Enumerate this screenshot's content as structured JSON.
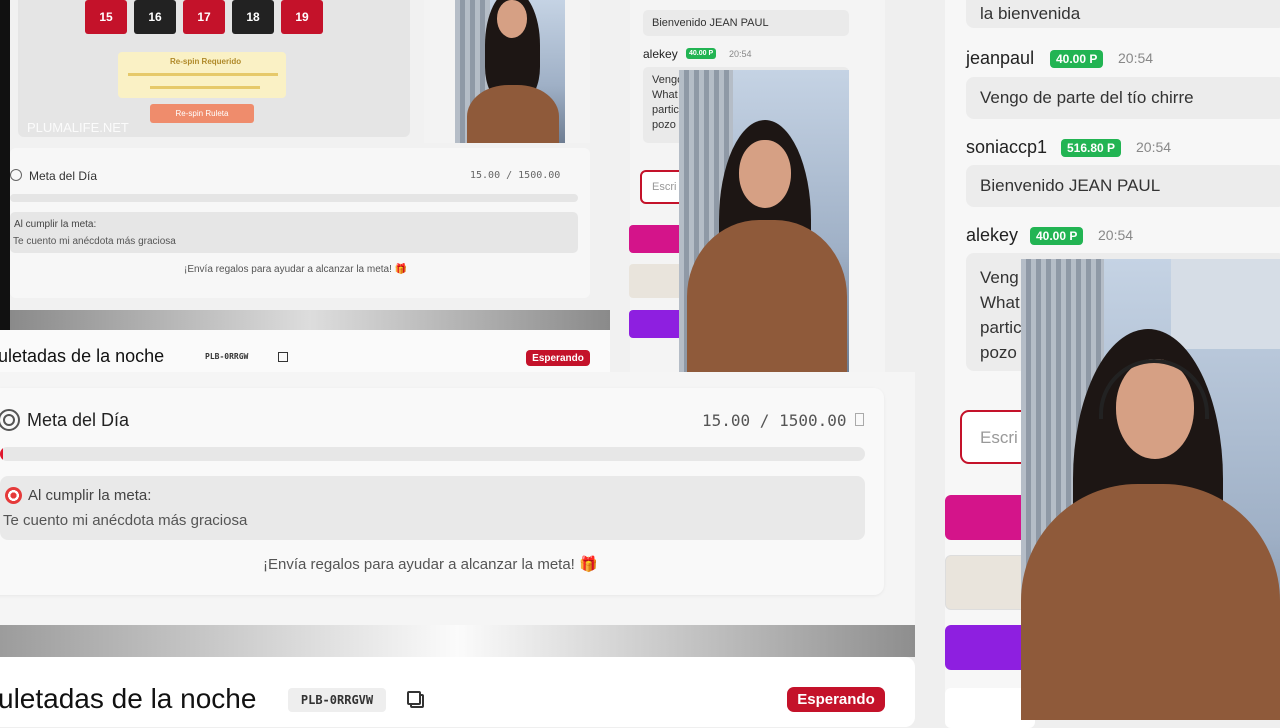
{
  "main": {
    "goal": {
      "title": "Meta del Día",
      "progress": "15.00 / 1500.00",
      "progress_fraction": 0.01,
      "reward_label": "Al cumplir la meta:",
      "reward_text": "Te cuento mi anécdota más graciosa",
      "cta": "¡Envía regalos para ayudar a alcanzar la meta! 🎁"
    },
    "roulette": {
      "title": "uletadas de la noche",
      "code": "PLB-0RRGVW",
      "status": "Esperando"
    },
    "watermark": "PLUMALIFE.NET"
  },
  "embedded": {
    "numbers": [
      {
        "n": "15",
        "color": "#c4122a"
      },
      {
        "n": "16",
        "color": "#222"
      },
      {
        "n": "17",
        "color": "#c4122a"
      },
      {
        "n": "18",
        "color": "#222"
      },
      {
        "n": "19",
        "color": "#c4122a"
      }
    ],
    "respin_title": "Re-spin Requerido",
    "respin_button": "Re-spin Ruleta",
    "watermark": "PLUMALIFE.NET",
    "goal": {
      "title": "Meta del Día",
      "progress": "15.00 / 1500.00",
      "reward_label": "Al cumplir la meta:",
      "reward_text": "Te cuento mi anécdota más graciosa",
      "cta": "¡Envía regalos para ayudar a alcanzar la meta! 🎁"
    },
    "roulette": {
      "title": "uletadas de la noche",
      "code": "PLB-0RRGW",
      "status": "Esperando"
    },
    "chat": {
      "msg1": "Bienvenido JEAN PAUL",
      "user": "alekey",
      "points": "40.00 P",
      "time": "20:54",
      "msg2_lines": [
        "Vengo",
        "What",
        "partic",
        "pozo"
      ],
      "input_placeholder": "Escri"
    }
  },
  "chat": {
    "top_fragment": "la bienvenida",
    "messages": [
      {
        "user": "jeanpaul",
        "points": "40.00 P",
        "time": "20:54",
        "text": "Vengo de parte del tío chirre"
      },
      {
        "user": "soniaccp1",
        "points": "516.80 P",
        "time": "20:54",
        "text": "Bienvenido JEAN PAUL"
      },
      {
        "user": "alekey",
        "points": "40.00 P",
        "time": "20:54",
        "lines": [
          "Veng",
          "What",
          "partic",
          "pozo"
        ]
      }
    ],
    "input_placeholder": "Escri",
    "gift_colors": [
      "#d4148a",
      "#e9e4dc",
      "#8e1fe0"
    ]
  }
}
